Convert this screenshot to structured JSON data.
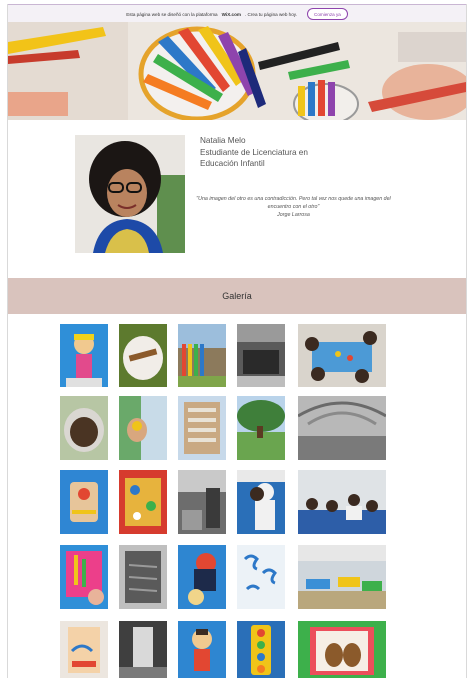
{
  "wix_banner": {
    "text_before": "Esta página web se diseñó con la plataforma",
    "brand": "WiX.com",
    "text_after": ". Crea tu página web hoy.",
    "button_label": "Comienza ya"
  },
  "profile": {
    "name": "Natalia Melo",
    "role": "Estudiante de Licenciatura en Educación Infantil",
    "quote": "\"Una imagen del otro es una contradicción. Pero tal vez nos quede una imagen del encuentro con el otro\"",
    "quote_author": "Jorge Larrosa"
  },
  "gallery": {
    "title": "Galería",
    "tiles": [
      {
        "id": "1"
      },
      {
        "id": "2"
      },
      {
        "id": "3"
      },
      {
        "id": "4"
      },
      {
        "id": "5"
      },
      {
        "id": "6"
      },
      {
        "id": "7"
      },
      {
        "id": "8"
      },
      {
        "id": "9"
      },
      {
        "id": "10"
      },
      {
        "id": "11"
      },
      {
        "id": "12"
      },
      {
        "id": "13"
      },
      {
        "id": "14"
      },
      {
        "id": "15"
      },
      {
        "id": "16"
      },
      {
        "id": "17"
      },
      {
        "id": "18"
      },
      {
        "id": "19"
      },
      {
        "id": "20"
      },
      {
        "id": "21"
      },
      {
        "id": "22"
      },
      {
        "id": "23"
      },
      {
        "id": "24"
      },
      {
        "id": "25"
      }
    ]
  }
}
